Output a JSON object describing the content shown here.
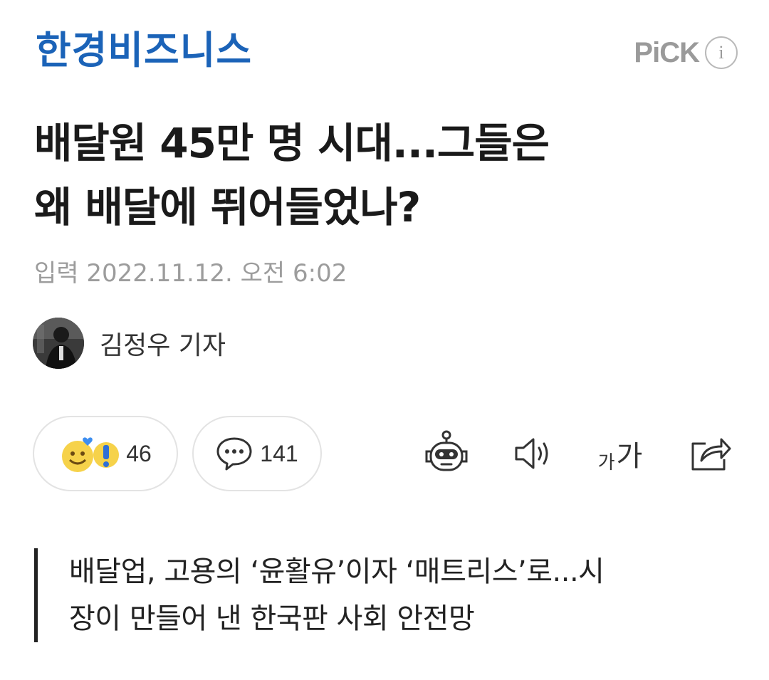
{
  "header": {
    "press_name": "한경비즈니스",
    "pick_label": "PiCK",
    "info_glyph": "i"
  },
  "article": {
    "headline_line1": "배달원 45만 명 시대...그들은",
    "headline_line2": "왜 배달에 뛰어들었나?",
    "published": "입력 2022.11.12. 오전 6:02",
    "reporter": "김정우 기자",
    "subtitle_line1": "배달업, 고용의 ‘윤활유’이자 ‘매트리스’로...시",
    "subtitle_line2": "장이 만들어 낸 한국판 사회 안전망"
  },
  "toolbar": {
    "reaction_count": "46",
    "comment_count": "141",
    "font_small": "가",
    "font_large": "가",
    "icons": [
      "reaction-emoji-icon",
      "comment-bubble-icon",
      "summary-bot-icon",
      "speaker-icon",
      "font-size-icon",
      "share-icon"
    ]
  },
  "colors": {
    "brand_blue": "#1b63b8",
    "muted_gray": "#9c9c9c",
    "pill_border": "#e3e3e3"
  }
}
